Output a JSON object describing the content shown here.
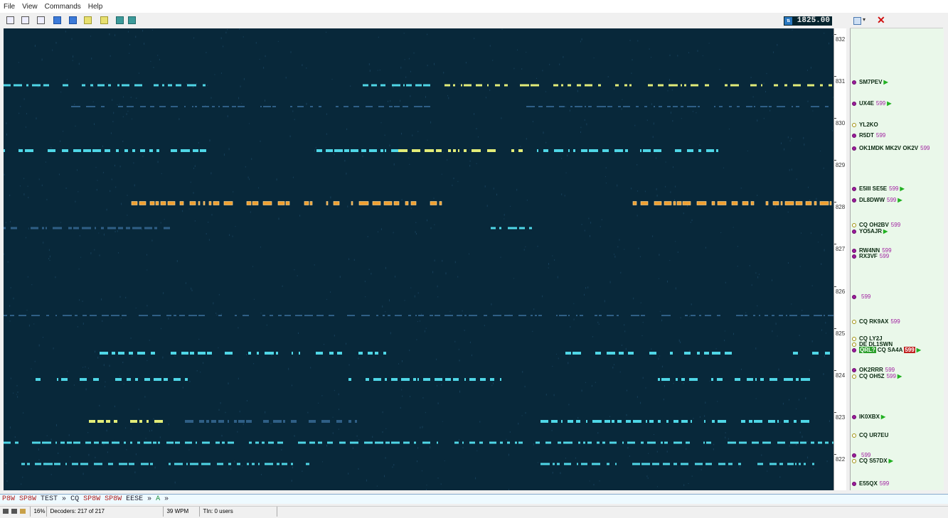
{
  "menu": [
    "File",
    "View",
    "Commands",
    "Help"
  ],
  "toolbar": {
    "freq_display": "1825.00",
    "buttons": [
      "camera-icon",
      "keyboard-icon",
      "speaker-icon",
      "download-icon",
      "save-icon",
      "marker-icon",
      "notepad-icon",
      "zoom-icon",
      "window-icon"
    ]
  },
  "scale": {
    "ticks": [
      "832",
      "831",
      "830",
      "829",
      "828",
      "827",
      "826",
      "825",
      "824",
      "823",
      "822"
    ]
  },
  "spots": [
    {
      "call": "SM7PEV",
      "rst": "",
      "arrow": true,
      "dot": "p"
    },
    {
      "call": "UX4E",
      "rst": "599",
      "arrow": true,
      "dot": "p"
    },
    {
      "call": "YL2KO",
      "rst": "",
      "arrow": false,
      "dot": "y"
    },
    {
      "call": "R5DT",
      "rst": "599",
      "arrow": false,
      "dot": "p"
    },
    {
      "call": "OK1MDK MK2V OK2V",
      "rst": "599",
      "arrow": false,
      "dot": "p"
    },
    {
      "call": "E5III SE5E",
      "rst": "599",
      "arrow": true,
      "dot": "p"
    },
    {
      "call": "DL8DWW",
      "rst": "599",
      "arrow": true,
      "dot": "p"
    },
    {
      "call": "CQ OH2BV",
      "rst": "599",
      "arrow": false,
      "dot": "y"
    },
    {
      "call": "YO5AJR",
      "rst": "",
      "arrow": true,
      "dot": "p"
    },
    {
      "call": "RW4NN",
      "rst": "599",
      "arrow": false,
      "dot": "p"
    },
    {
      "call": "RX3VF",
      "rst": "599",
      "arrow": false,
      "dot": "p"
    },
    {
      "call": "",
      "rst": "599",
      "arrow": false,
      "dot": "p"
    },
    {
      "call": "CQ RK9AX",
      "rst": "599",
      "arrow": false,
      "dot": "y"
    },
    {
      "call": "CQ LY2J",
      "rst": "",
      "arrow": false,
      "dot": "y"
    },
    {
      "call": "DE DL1SWN",
      "rst": "",
      "arrow": false,
      "dot": "y"
    },
    {
      "call": "CQ SA4A",
      "rst": "599",
      "arrow": true,
      "dot": "p",
      "tag": "QRL?"
    },
    {
      "call": "OK2RRR",
      "rst": "599",
      "arrow": false,
      "dot": "p"
    },
    {
      "call": "CQ OH5Z",
      "rst": "599",
      "arrow": true,
      "dot": "y"
    },
    {
      "call": "IK0XBX",
      "rst": "",
      "arrow": true,
      "dot": "p"
    },
    {
      "call": "CQ UR7EU",
      "rst": "",
      "arrow": false,
      "dot": "y"
    },
    {
      "call": "",
      "rst": "599",
      "arrow": false,
      "dot": "p"
    },
    {
      "call": "CQ S57DX",
      "rst": "",
      "arrow": true,
      "dot": "y"
    },
    {
      "call": "E55QX",
      "rst": "599",
      "arrow": false,
      "dot": "p"
    }
  ],
  "decode_line": [
    {
      "t": "P8W",
      "c": "red"
    },
    {
      "t": "SP8W",
      "c": "red"
    },
    {
      "t": "TEST",
      "c": "blk"
    },
    {
      "t": "»",
      "c": "blk"
    },
    {
      "t": "CQ",
      "c": "blk"
    },
    {
      "t": "SP8W",
      "c": "red"
    },
    {
      "t": "SP8W",
      "c": "red"
    },
    {
      "t": "EESE",
      "c": "blk"
    },
    {
      "t": "»",
      "c": "blk"
    },
    {
      "t": "A",
      "c": "grn"
    },
    {
      "t": "»",
      "c": "blk"
    }
  ],
  "status": {
    "cpu": "16%",
    "decoders": "Decoders: 217 of 217",
    "wpm": "39 WPM",
    "users": "TIn: 0 users"
  },
  "colors": {
    "waterfall_bg": "#08283a",
    "trace_cyan": "#4fd6e6",
    "trace_yellow": "#e2ec78",
    "trace_orange": "#f0a030",
    "trace_dim": "#2f5f86"
  }
}
